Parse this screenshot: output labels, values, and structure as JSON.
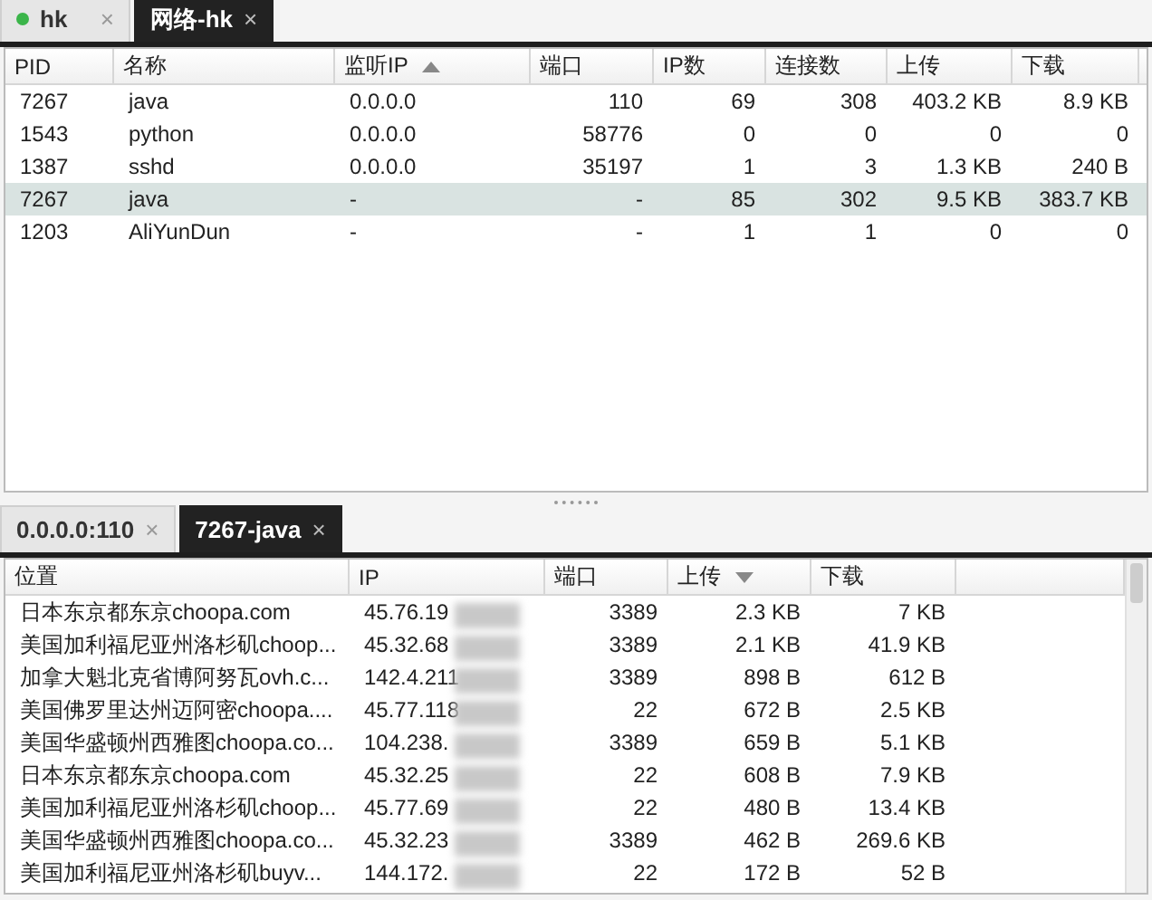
{
  "top_tabs": [
    {
      "label": "hk",
      "close": "×",
      "selected": false,
      "status_dot": true
    },
    {
      "label": "网络-hk",
      "close": "×",
      "selected": true,
      "status_dot": false
    }
  ],
  "process_table": {
    "columns": [
      {
        "label": "PID",
        "right_aligned": false,
        "sorted": false
      },
      {
        "label": "名称",
        "right_aligned": false,
        "sorted": false
      },
      {
        "label": "监听IP",
        "right_aligned": false,
        "sorted": true,
        "descending": false
      },
      {
        "label": "端口",
        "right_aligned": true,
        "sorted": false
      },
      {
        "label": "IP数",
        "right_aligned": true,
        "sorted": false
      },
      {
        "label": "连接数",
        "right_aligned": true,
        "sorted": false
      },
      {
        "label": "上传",
        "right_aligned": true,
        "sorted": false
      },
      {
        "label": "下载",
        "right_aligned": true,
        "sorted": false
      }
    ],
    "rows": [
      {
        "selected": false,
        "cells": [
          "7267",
          "java",
          "0.0.0.0",
          "110",
          "69",
          "308",
          "403.2 KB",
          "8.9 KB"
        ]
      },
      {
        "selected": false,
        "cells": [
          "1543",
          "python",
          "0.0.0.0",
          "58776",
          "0",
          "0",
          "0",
          "0"
        ]
      },
      {
        "selected": false,
        "cells": [
          "1387",
          "sshd",
          "0.0.0.0",
          "35197",
          "1",
          "3",
          "1.3 KB",
          "240 B"
        ]
      },
      {
        "selected": true,
        "cells": [
          "7267",
          "java",
          "-",
          "-",
          "85",
          "302",
          "9.5 KB",
          "383.7 KB"
        ]
      },
      {
        "selected": false,
        "cells": [
          "1203",
          "AliYunDun",
          "-",
          "-",
          "1",
          "1",
          "0",
          "0"
        ]
      }
    ]
  },
  "bottom_tabs": [
    {
      "label": "0.0.0.0:110",
      "close": "×",
      "selected": false
    },
    {
      "label": "7267-java",
      "close": "×",
      "selected": true
    }
  ],
  "connection_table": {
    "columns": [
      {
        "label": "位置",
        "right_aligned": false,
        "sorted": false
      },
      {
        "label": "IP",
        "right_aligned": false,
        "sorted": false
      },
      {
        "label": "端口",
        "right_aligned": true,
        "sorted": false
      },
      {
        "label": "上传",
        "right_aligned": true,
        "sorted": true,
        "descending": true
      },
      {
        "label": "下载",
        "right_aligned": true,
        "sorted": false
      }
    ],
    "rows": [
      {
        "cells": [
          "日本东京都东京choopa.com",
          "45.76.19",
          "3389",
          "2.3 KB",
          "7 KB"
        ]
      },
      {
        "cells": [
          "美国加利福尼亚州洛杉矶choop...",
          "45.32.68",
          "3389",
          "2.1 KB",
          "41.9 KB"
        ]
      },
      {
        "cells": [
          "加拿大魁北克省博阿努瓦ovh.c...",
          "142.4.211",
          "3389",
          "898 B",
          "612 B"
        ]
      },
      {
        "cells": [
          "美国佛罗里达州迈阿密choopa....",
          "45.77.118",
          "22",
          "672 B",
          "2.5 KB"
        ]
      },
      {
        "cells": [
          "美国华盛顿州西雅图choopa.co...",
          "104.238.",
          "3389",
          "659 B",
          "5.1 KB"
        ]
      },
      {
        "cells": [
          "日本东京都东京choopa.com",
          "45.32.25",
          "22",
          "608 B",
          "7.9 KB"
        ]
      },
      {
        "cells": [
          "美国加利福尼亚州洛杉矶choop...",
          "45.77.69",
          "22",
          "480 B",
          "13.4 KB"
        ]
      },
      {
        "cells": [
          "美国华盛顿州西雅图choopa.co...",
          "45.32.23",
          "3389",
          "462 B",
          "269.6 KB"
        ]
      },
      {
        "cells": [
          "美国加利福尼亚州洛杉矶buyv...",
          "144.172.",
          "22",
          "172 B",
          "52 B"
        ]
      }
    ]
  }
}
